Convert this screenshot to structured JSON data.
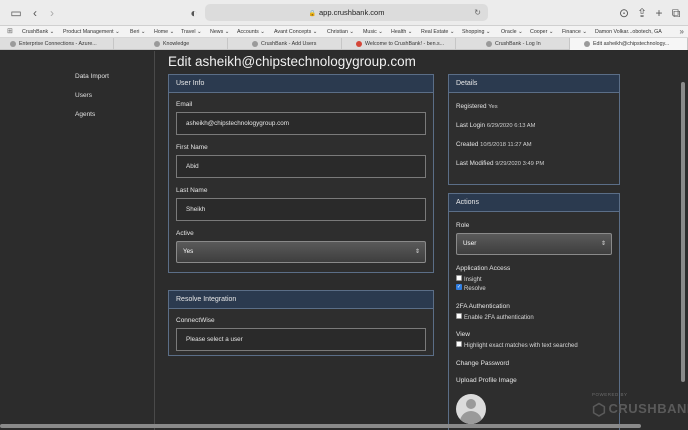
{
  "browser": {
    "url": "app.crushbank.com",
    "bookmarks": [
      "CrushBank ⌄",
      "Product Management ⌄",
      "Beri ⌄",
      "Home ⌄",
      "Travel ⌄",
      "News ⌄",
      "Accounts ⌄",
      "Avant Concepts ⌄",
      "Christian ⌄",
      "Music ⌄",
      "Health ⌄",
      "Real Estate ⌄",
      "Shopping ⌄",
      "Oracle ⌄",
      "Cooper ⌄",
      "Finance ⌄",
      "Damon Volkar...obotech, GA"
    ],
    "tabs": [
      "Enterprise Connections - Azure...",
      "Knowledge",
      "CrushBank - Add Users",
      "Welcome to CrushBank! - ben.s...",
      "CrushBank - Log In",
      "Edit asheikh@chipstechnology..."
    ]
  },
  "sidebar": {
    "items": [
      "Data Import",
      "Users",
      "Agents"
    ]
  },
  "page_title": "Edit asheikh@chipstechnologygroup.com",
  "user_info": {
    "heading": "User Info",
    "email_label": "Email",
    "email_value": "asheikh@chipstechnologygroup.com",
    "first_name_label": "First Name",
    "first_name_value": "Abid",
    "last_name_label": "Last Name",
    "last_name_value": "Sheikh",
    "active_label": "Active",
    "active_value": "Yes"
  },
  "resolve_integration": {
    "heading": "Resolve Integration",
    "connectwise_label": "ConnectWise",
    "connectwise_placeholder": "Please select a user"
  },
  "details": {
    "heading": "Details",
    "rows": [
      {
        "label": "Registered",
        "value": "Yes"
      },
      {
        "label": "Last Login",
        "value": "6/29/2020 6:13 AM"
      },
      {
        "label": "Created",
        "value": "10/5/2018 11:27 AM"
      },
      {
        "label": "Last Modified",
        "value": "9/29/2020 3:49 PM"
      }
    ]
  },
  "actions": {
    "heading": "Actions",
    "role_label": "Role",
    "role_value": "User",
    "app_access_label": "Application Access",
    "insight_label": "Insight",
    "insight_checked": false,
    "resolve_label": "Resolve",
    "resolve_checked": true,
    "twofa_label": "2FA Authentication",
    "enable_2fa_label": "Enable 2FA authentication",
    "view_label": "View",
    "highlight_label": "Highlight exact matches with text searched",
    "change_password": "Change Password",
    "upload_profile": "Upload Profile Image"
  },
  "branding": {
    "powered_by": "POWERED BY",
    "logo_text": "CRUSHBANK"
  },
  "colors": {
    "panel_header": "#2b3a4f",
    "panel_border": "#5b6e87",
    "background": "#2c2c2c",
    "checkbox_on": "#2f7de1"
  }
}
